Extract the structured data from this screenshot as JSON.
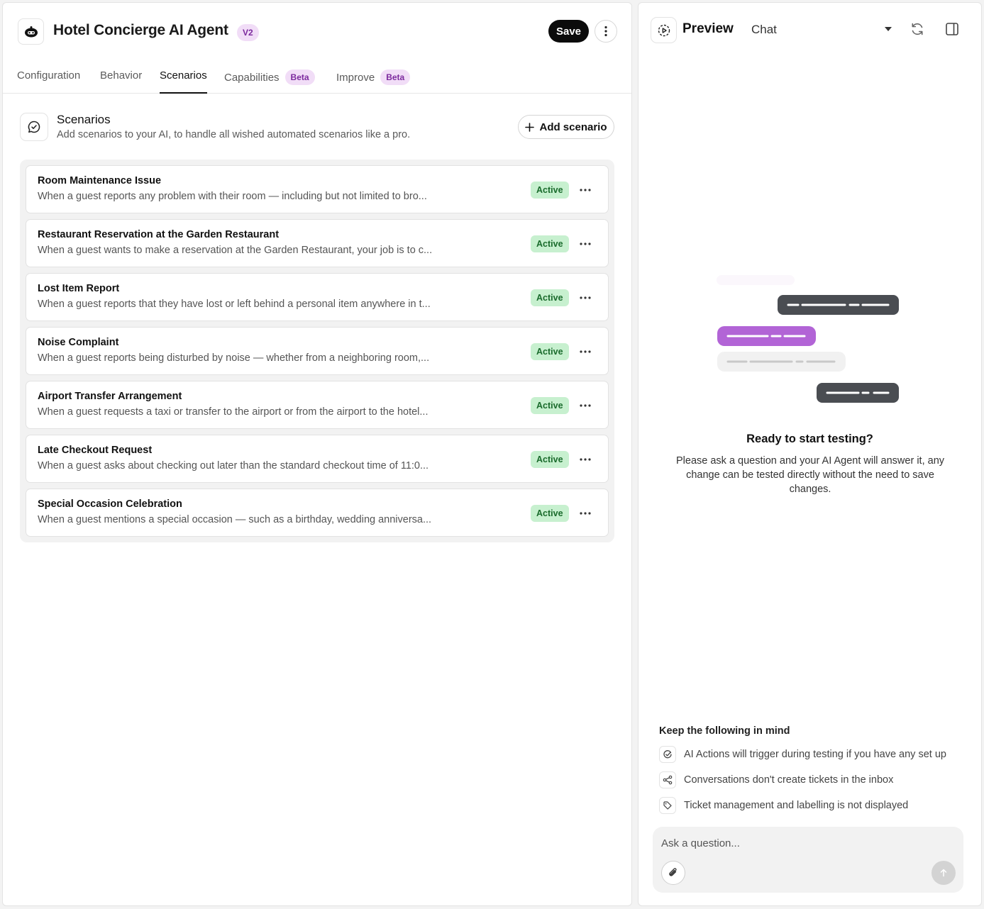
{
  "header": {
    "title": "Hotel Concierge AI Agent",
    "version": "V2",
    "save_label": "Save"
  },
  "tabs": [
    {
      "label": "Configuration",
      "badge": ""
    },
    {
      "label": "Behavior",
      "badge": ""
    },
    {
      "label": "Scenarios",
      "badge": "",
      "active": true
    },
    {
      "label": "Capabilities",
      "badge": "Beta"
    },
    {
      "label": "Improve",
      "badge": "Beta"
    }
  ],
  "section": {
    "title": "Scenarios",
    "subtitle": "Add scenarios to your AI, to handle all wished automated scenarios like a pro.",
    "add_label": "Add scenario"
  },
  "scenarios": [
    {
      "name": "Room Maintenance Issue",
      "description": "When a guest reports any problem with their room — including but not limited to bro...",
      "status": "Active"
    },
    {
      "name": "Restaurant Reservation at the Garden Restaurant",
      "description": "When a guest wants to make a reservation at the Garden Restaurant, your job is to c...",
      "status": "Active"
    },
    {
      "name": "Lost Item Report",
      "description": "When a guest reports that they have lost or left behind a personal item anywhere in t...",
      "status": "Active"
    },
    {
      "name": "Noise Complaint",
      "description": "When a guest reports being disturbed by noise — whether from a neighboring room,...",
      "status": "Active"
    },
    {
      "name": "Airport Transfer Arrangement",
      "description": "When a guest requests a taxi or transfer to the airport or from the airport to the hotel...",
      "status": "Active"
    },
    {
      "name": "Late Checkout Request",
      "description": "When a guest asks about checking out later than the standard checkout time of 11:0...",
      "status": "Active"
    },
    {
      "name": "Special Occasion Celebration",
      "description": "When a guest mentions a special occasion — such as a birthday, wedding anniversa...",
      "status": "Active"
    }
  ],
  "preview": {
    "title": "Preview",
    "mode": "Chat",
    "ready_title": "Ready to start testing?",
    "ready_text": "Please ask a question and your AI Agent will answer it, any change can be tested directly without the need to save changes.",
    "tips_title": "Keep the following in mind",
    "tips": [
      {
        "icon": "ai-actions-icon",
        "text": "AI Actions will trigger during testing if you have any set up"
      },
      {
        "icon": "share-icon",
        "text": "Conversations don't create tickets in the inbox"
      },
      {
        "icon": "tag-icon",
        "text": "Ticket management and labelling is not displayed"
      }
    ],
    "input_placeholder": "Ask a question..."
  },
  "colors": {
    "accent_purple": "#b264d6",
    "badge_purple_bg": "#f1ddf7",
    "active_green_bg": "#c7f0cf",
    "dark_bubble": "#4a4d52"
  }
}
